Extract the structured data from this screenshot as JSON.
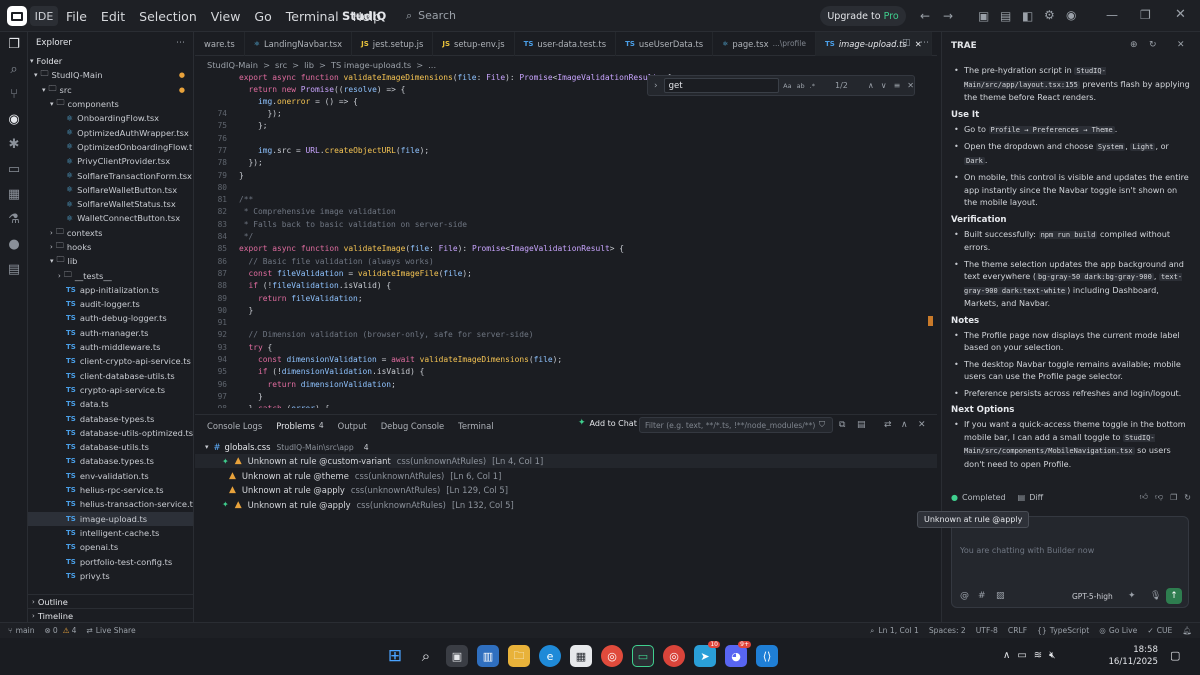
{
  "titlebar": {
    "ide_label": "IDE",
    "menu": [
      "File",
      "Edit",
      "Selection",
      "View",
      "Go",
      "Terminal",
      "Help"
    ],
    "project": "StudIQ",
    "search_placeholder": "Search",
    "upgrade_text": "Upgrade to",
    "upgrade_pro": "Pro"
  },
  "explorer": {
    "title": "Explorer",
    "folder_label": "Folder",
    "root": "StudIQ-Main",
    "src": "src",
    "components": "components",
    "component_files": [
      "OnboardingFlow.tsx",
      "OptimizedAuthWrapper.tsx",
      "OptimizedOnboardingFlow.t...",
      "PrivyClientProvider.tsx",
      "SolflareTransactionForm.tsx",
      "SolflareWalletButton.tsx",
      "SolflareWalletStatus.tsx",
      "WalletConnectButton.tsx"
    ],
    "folders": [
      "contexts",
      "hooks",
      "lib"
    ],
    "lib_tests": "__tests__",
    "lib_files": [
      "app-initialization.ts",
      "audit-logger.ts",
      "auth-debug-logger.ts",
      "auth-manager.ts",
      "auth-middleware.ts",
      "client-crypto-api-service.ts",
      "client-database-utils.ts",
      "crypto-api-service.ts",
      "data.ts",
      "database-types.ts",
      "database-utils-optimized.ts",
      "database-utils.ts",
      "database.types.ts",
      "env-validation.ts",
      "helius-rpc-service.ts",
      "helius-transaction-service.ts",
      "image-upload.ts",
      "intelligent-cache.ts",
      "openai.ts",
      "portfolio-test-config.ts",
      "privy.ts"
    ],
    "ts_badge": "TS",
    "outline": "Outline",
    "timeline": "Timeline"
  },
  "tabs": [
    {
      "label": "ware.ts",
      "active": false
    },
    {
      "label": "LandingNavbar.tsx",
      "active": false
    },
    {
      "label": "jest.setup.js",
      "active": false
    },
    {
      "label": "setup-env.js",
      "active": false
    },
    {
      "label": "user-data.test.ts",
      "active": false
    },
    {
      "label": "useUserData.ts",
      "active": false
    },
    {
      "label": "page.tsx",
      "extra": "...\\profile",
      "active": false
    },
    {
      "label": "image-upload.ts",
      "active": true
    }
  ],
  "breadcrumb": [
    "StudIQ-Main",
    ">",
    "src",
    ">",
    "lib",
    ">",
    "TS image-upload.ts",
    ">",
    "..."
  ],
  "find": {
    "value": "get",
    "count": "1/2"
  },
  "code": {
    "header1": "export async function validateImageDimensions(file: File): Promise<ImageValidationResult> {",
    "header2": "  return new Promise((resolve) => {",
    "header3": "    img.onerror = () => {",
    "lines": [
      {
        "n": "74",
        "t": "      });"
      },
      {
        "n": "75",
        "t": "    };"
      },
      {
        "n": "76",
        "t": ""
      },
      {
        "n": "77",
        "t": "    img.src = URL.createObjectURL(file);"
      },
      {
        "n": "78",
        "t": "  });"
      },
      {
        "n": "79",
        "t": "}"
      },
      {
        "n": "80",
        "t": ""
      },
      {
        "n": "81",
        "t": "/**"
      },
      {
        "n": "82",
        "t": " * Comprehensive image validation"
      },
      {
        "n": "83",
        "t": " * Falls back to basic validation on server-side"
      },
      {
        "n": "84",
        "t": " */"
      },
      {
        "n": "85",
        "t": "export async function validateImage(file: File): Promise<ImageValidationResult> {"
      },
      {
        "n": "86",
        "t": "  // Basic file validation (always works)"
      },
      {
        "n": "87",
        "t": "  const fileValidation = validateImageFile(file);"
      },
      {
        "n": "88",
        "t": "  if (!fileValidation.isValid) {"
      },
      {
        "n": "89",
        "t": "    return fileValidation;"
      },
      {
        "n": "90",
        "t": "  }"
      },
      {
        "n": "91",
        "t": ""
      },
      {
        "n": "92",
        "t": "  // Dimension validation (browser-only, safe for server-side)"
      },
      {
        "n": "93",
        "t": "  try {"
      },
      {
        "n": "94",
        "t": "    const dimensionValidation = await validateImageDimensions(file);"
      },
      {
        "n": "95",
        "t": "    if (!dimensionValidation.isValid) {"
      },
      {
        "n": "96",
        "t": "      return dimensionValidation;"
      },
      {
        "n": "97",
        "t": "    }"
      },
      {
        "n": "98",
        "t": "  } catch (error) {"
      }
    ]
  },
  "panel": {
    "tabs": [
      "Console Logs",
      "Problems",
      "Output",
      "Debug Console",
      "Terminal"
    ],
    "problems_count": "4",
    "add_to_chat": "Add to Chat",
    "filter_placeholder": "Filter (e.g. text, **/*.ts, !**/node_modules/**)",
    "file": "globals.css",
    "file_path": "StudIQ-Main\\src\\app",
    "file_count": "4",
    "problems": [
      {
        "msg": "Unknown at rule @custom-variant",
        "src": "css(unknownAtRules)",
        "loc": "[Ln 4, Col 1]"
      },
      {
        "msg": "Unknown at rule @theme",
        "src": "css(unknownAtRules)",
        "loc": "[Ln 6, Col 1]"
      },
      {
        "msg": "Unknown at rule @apply",
        "src": "css(unknownAtRules)",
        "loc": "[Ln 129, Col 5]"
      },
      {
        "msg": "Unknown at rule @apply",
        "src": "css(unknownAtRules)",
        "loc": "[Ln 132, Col 5]"
      }
    ]
  },
  "chat": {
    "title": "TRAE",
    "intro": {
      "a": "The pre-hydration script in",
      "code1": "StudIQ-Main/src/app/layout.tsx:155",
      "b": "prevents flash by applying the theme before React renders."
    },
    "use_it_title": "Use It",
    "use_it": {
      "a1": "Go to",
      "c1": "Profile → Preferences → Theme",
      "b1": "Open the dropdown and choose",
      "c2": "System",
      "c3": "Light",
      "or": ", or",
      "c4": "Dark",
      "m1": "On mobile, this control is visible and updates the entire app instantly since the Navbar toggle isn't shown on the mobile layout."
    },
    "verification_title": "Verification",
    "verification": {
      "a1": "Built successfully:",
      "c1": "npm run build",
      "b1": "compiled without errors.",
      "a2": "The theme selection updates the app background and text everywhere (",
      "c2": "bg-gray-50 dark:bg-gray-900",
      "c3": "text-gray-900 dark:text-white",
      "b2": ") including Dashboard, Markets, and Navbar."
    },
    "notes_title": "Notes",
    "notes": [
      "The Profile page now displays the current mode label based on your selection.",
      "The desktop Navbar toggle remains available; mobile users can use the Profile page selector.",
      "Preference persists across refreshes and login/logout."
    ],
    "next_title": "Next Options",
    "next": {
      "a": "If you want a quick-access theme toggle in the bottom mobile bar, I can add a small toggle to",
      "code": "StudIQ-Main/src/components/MobileNavigation.tsx",
      "b": "so users don't need to open Profile."
    },
    "completed": "Completed",
    "diff": "Diff",
    "tooltip": "Unknown at rule @apply",
    "input_placeholder": "You are chatting with Builder now",
    "model": "GPT-5-high"
  },
  "status": {
    "branch": "main",
    "errors": "0",
    "warnings": "4",
    "live_share": "Live Share",
    "ln_col": "Ln 1, Col 1",
    "spaces": "Spaces: 2",
    "encoding": "UTF-8",
    "eol": "CRLF",
    "lang": "TypeScript",
    "golive": "Go Live",
    "cue": "CUE"
  },
  "taskbar": {
    "time": "18:58",
    "date": "16/11/2025",
    "badge_teams": "10",
    "badge_discord": "9+"
  },
  "colors": {
    "accent": "#4a9fe8",
    "warning": "#e8a23b",
    "pro": "#3fcf8e",
    "bg": "#1b1d22"
  }
}
